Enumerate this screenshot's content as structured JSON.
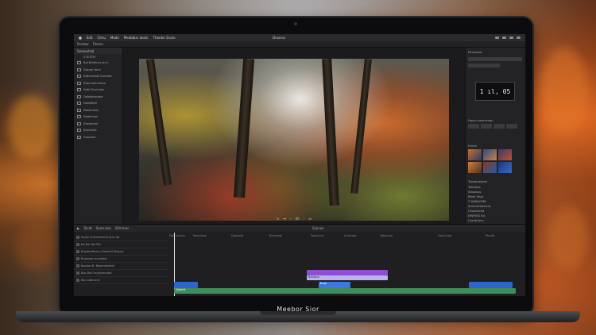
{
  "brand": "Meebor Sior",
  "menubar": {
    "items": [
      "Edit",
      "Clmu",
      "Mode",
      "Meebblar dastc",
      "Tteoder Dvcle"
    ],
    "title": "Drasera"
  },
  "toolbar": {
    "items": [
      "Perdow",
      "Fiemm"
    ]
  },
  "left_panel": {
    "header": "Sesseutsal",
    "tab": "Indutter",
    "items": [
      "Bal Betetrus stu t",
      "Dacsor ibrnl",
      "Didcudmeli bunsest",
      "Dauunehrorbus",
      "Dettl Sucti ato",
      "Deldderscebs",
      "Dalsflitirh",
      "Dastrvinss",
      "Dadlcheol",
      "Declomerl",
      "Sascheirt",
      "Dasckerl"
    ]
  },
  "viewer": {
    "controls": [
      "↻",
      "⏮",
      "‹",
      "00",
      "›",
      "⏭"
    ]
  },
  "right_panel": {
    "header": "Mnalstror",
    "timecode": "1 ıl, 05",
    "section_color": "Hosur anourmon",
    "section_media": "Emtin",
    "params_title": "Tronanestain",
    "params": [
      "Tolnetes",
      "Slavasss",
      "Plam Ehot",
      "T ARKHOME",
      "Somanthatoms",
      "Chastheed",
      "EHJMOS Ed",
      "Cumtrilcm"
    ]
  },
  "timeline": {
    "toolbar": [
      "Tacdt",
      "Semcclex",
      "Sfimmec"
    ],
    "center_label": "Sliones",
    "ruler": [
      "Dolt Ionnus",
      "Mesndcor",
      "Dasduiel",
      "Bsrckreal",
      "Toevd.ins",
      "Srorlcost",
      "Balicmal",
      "DaryCroal",
      "Pscnflt"
    ],
    "tracks": [
      "Dsihe Eretarfaeil Bulcnt lat",
      "Ba Bal Bol Bul",
      "Brasfoeflnecn Damle3l Basckl",
      "Bustreec bunidest",
      "Bautoo B. Basonsblorte",
      "Bas Bas hesolimnatal",
      "Bsu sabs anil"
    ],
    "clips": {
      "purple": "",
      "light": "Banana",
      "blue_mid": "Bubl",
      "green": "Dalteft"
    }
  }
}
